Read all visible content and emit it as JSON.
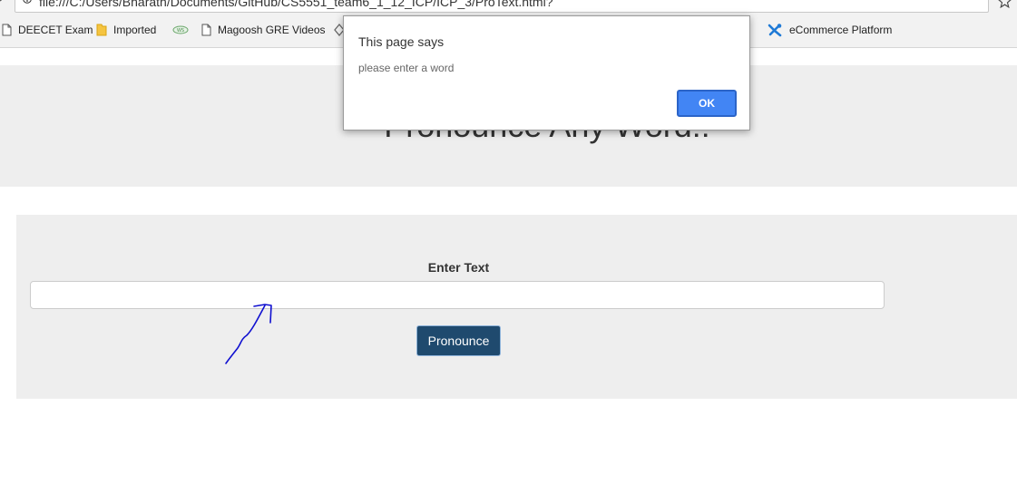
{
  "browser": {
    "url": "file:///C:/Users/Bharath/Documents/GitHub/CS5551_team6_1_12_ICP/ICP_3/ProText.html?",
    "bookmarks": [
      {
        "label": "DEECET Exam",
        "icon": "page-icon"
      },
      {
        "label": "Imported",
        "icon": "folder-icon"
      },
      {
        "label": "Magoosh GRE Videos",
        "icon": "page-icon"
      },
      {
        "label": "eCommerce Platform",
        "icon": "ecommerce-icon"
      }
    ]
  },
  "page": {
    "title": "Pronounce Any Word!!",
    "form": {
      "label": "Enter Text",
      "input_value": "",
      "button_label": "Pronounce"
    }
  },
  "alert": {
    "title": "This page says",
    "message": "please enter a word",
    "ok_label": "OK"
  },
  "colors": {
    "button_bg": "#1f4a6e",
    "ok_bg": "#4285f4",
    "panel_bg": "#eeeeee",
    "annotation": "#1010d0"
  }
}
